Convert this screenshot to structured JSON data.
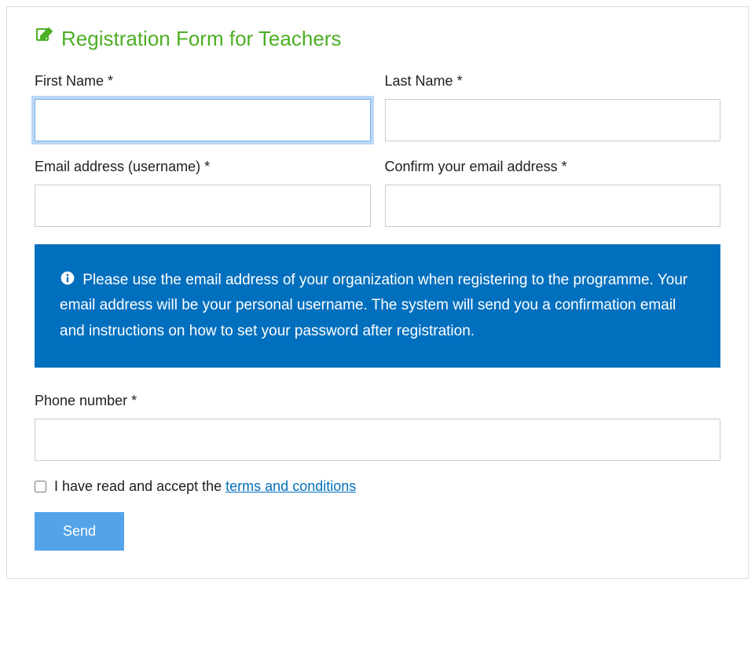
{
  "form": {
    "title": "Registration Form for Teachers",
    "firstName": {
      "label": "First Name *",
      "value": ""
    },
    "lastName": {
      "label": "Last Name *",
      "value": ""
    },
    "email": {
      "label": "Email address (username) *",
      "value": ""
    },
    "confirmEmail": {
      "label": "Confirm your email address *",
      "value": ""
    },
    "infoBanner": "Please use the email address of your organization when registering to the programme. Your email address will be your personal username. The system will send you a confirmation email and instructions on how to set your password after registration.",
    "phone": {
      "label": "Phone number *",
      "value": ""
    },
    "terms": {
      "prefix": "I have read and accept the ",
      "linkText": "terms and conditions"
    },
    "sendButton": "Send"
  }
}
